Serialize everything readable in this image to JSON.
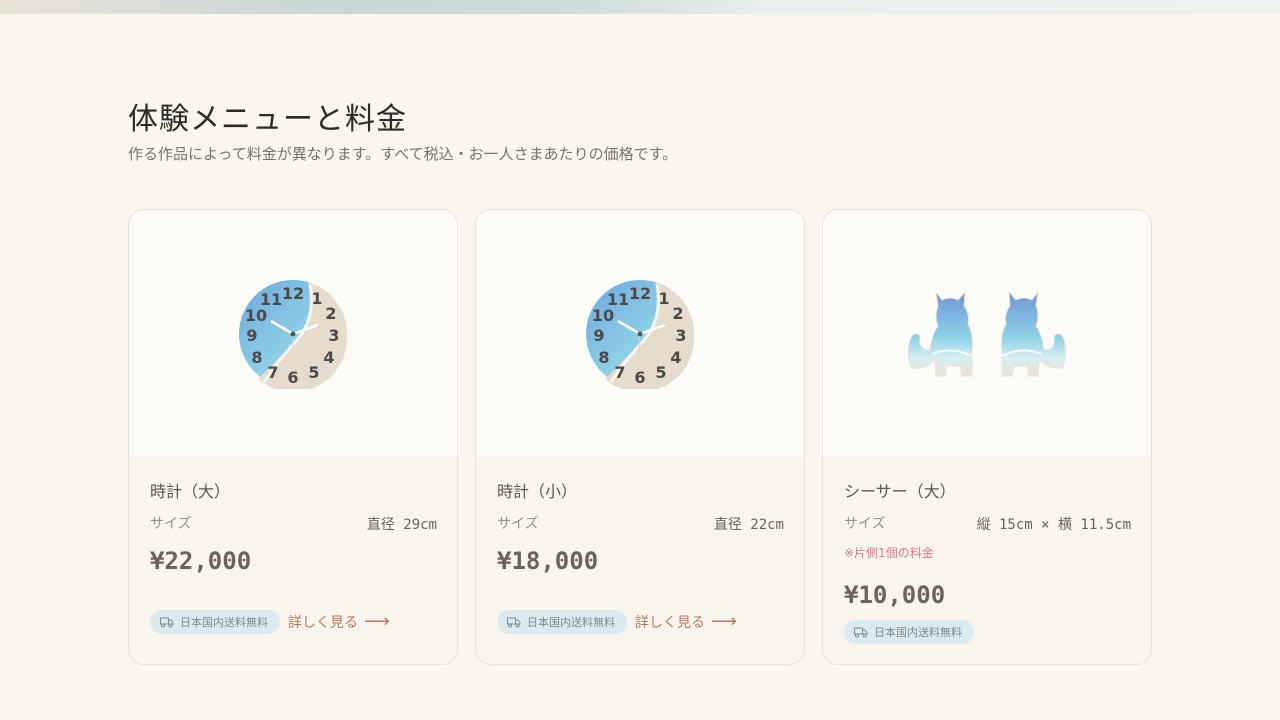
{
  "header": {
    "title": "体験メニューと料金",
    "subtitle": "作る作品によって料金が異なります。すべて税込・お一人さまあたりの価格です。"
  },
  "cards": [
    {
      "image_icon": "clock-beach-icon",
      "name": "時計（大）",
      "size_label": "サイズ",
      "size_value": "直径 29cm",
      "price": "¥22,000",
      "badge": "日本国内送料無料",
      "more_label": "詳しく見る"
    },
    {
      "image_icon": "clock-beach-icon",
      "name": "時計（小）",
      "size_label": "サイズ",
      "size_value": "直径 22cm",
      "price": "¥18,000",
      "badge": "日本国内送料無料",
      "more_label": "詳しく見る"
    },
    {
      "image_icon": "shisa-pair-icon",
      "name": "シーサー（大）",
      "size_label": "サイズ",
      "size_value": "縦 15cm × 横 11.5cm",
      "note": "※片側1個の料金",
      "price": "¥10,000",
      "badge": "日本国内送料無料"
    }
  ],
  "colors": {
    "background": "#f9f5ef",
    "badge_bg": "#dbeaee",
    "link": "#b87a5a",
    "note": "#d57a86"
  }
}
